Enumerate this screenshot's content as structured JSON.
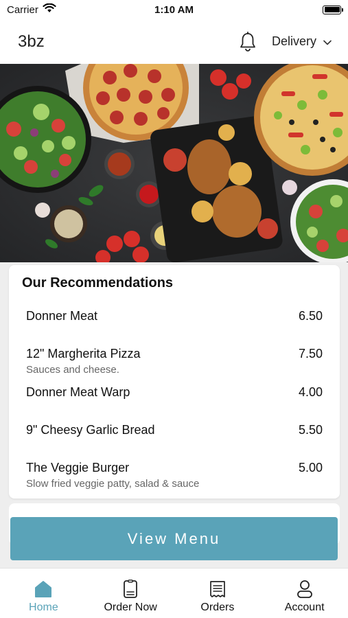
{
  "status_bar": {
    "carrier": "Carrier",
    "time": "1:10 AM"
  },
  "header": {
    "brand": "3bz",
    "mode_label": "Delivery"
  },
  "recommendations": {
    "title": "Our Recommendations",
    "items": [
      {
        "name": "Donner Meat",
        "price": "6.50",
        "description": ""
      },
      {
        "name": "12\" Margherita Pizza",
        "price": "7.50",
        "description": "Sauces and cheese."
      },
      {
        "name": "Donner Meat Warp",
        "price": "4.00",
        "description": ""
      },
      {
        "name": "9\" Cheesy Garlic Bread",
        "price": "5.50",
        "description": ""
      },
      {
        "name": "The Veggie Burger",
        "price": "5.00",
        "description": "Slow fried veggie patty, salad & sauce"
      }
    ]
  },
  "view_menu_label": "View Menu",
  "tabs": [
    {
      "label": "Home",
      "icon": "home-icon",
      "active": true
    },
    {
      "label": "Order Now",
      "icon": "order-sheet-icon",
      "active": false
    },
    {
      "label": "Orders",
      "icon": "receipt-icon",
      "active": false
    },
    {
      "label": "Account",
      "icon": "account-icon",
      "active": false
    }
  ],
  "colors": {
    "accent": "#5aa3b8",
    "background": "#eeeeee"
  }
}
